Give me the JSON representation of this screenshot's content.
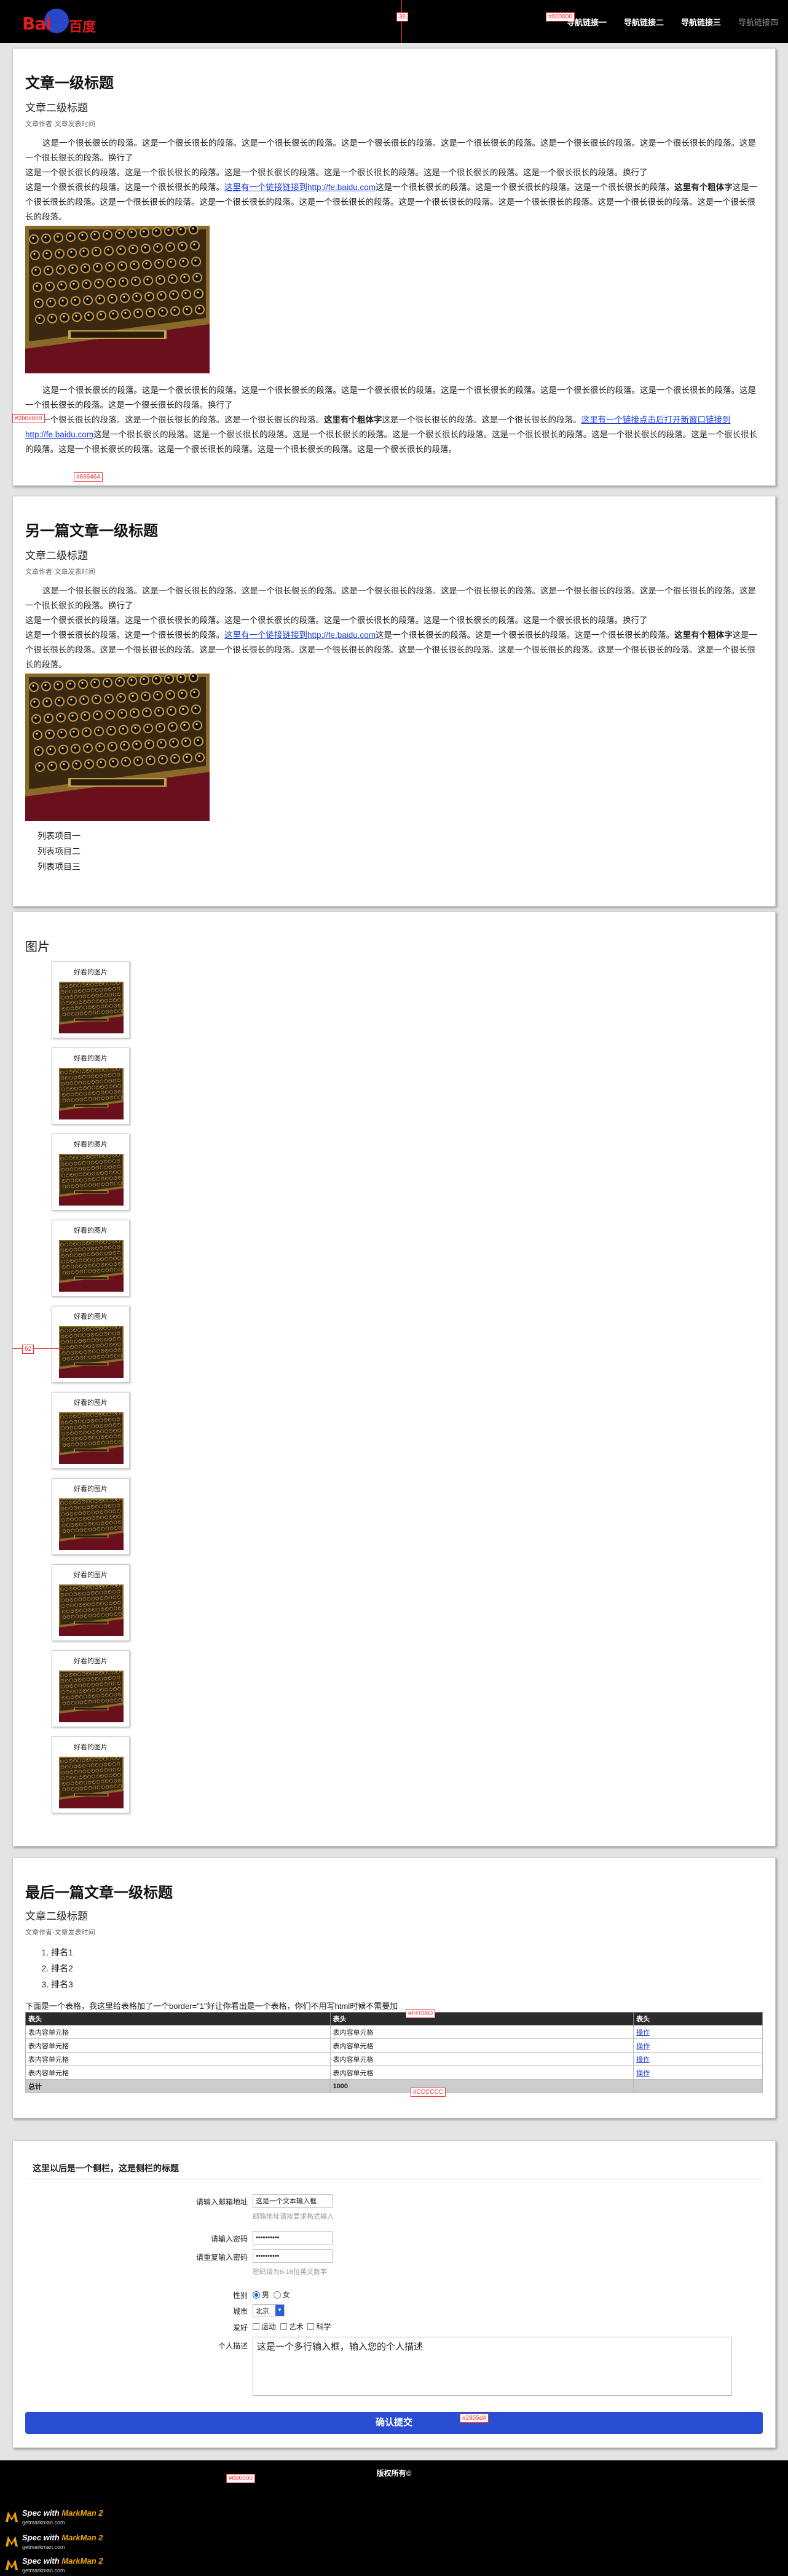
{
  "header": {
    "logo_text": "Bai",
    "logo_text2": "百度",
    "nav": [
      "导航链接一",
      "导航链接二",
      "导航链接三",
      "导航链接四"
    ]
  },
  "annotations": {
    "header_badge": "36",
    "header_color": "#000000",
    "card1_ann1": "#2b0e0e0",
    "card1_ann2": "#666464",
    "gallery_ann": "62",
    "table_ann": "#FF0000",
    "total_ann": "#CCCCCC",
    "form_ann": "#2855d4",
    "footer_color": "#000000"
  },
  "article1": {
    "title": "文章一级标题",
    "subtitle": "文章二级标题",
    "meta": "文章作者·文章发表时间",
    "p1": "这是一个很长很长的段落。这是一个很长很长的段落。这是一个很长很长的段落。这是一个很长很长的段落。这是一个很长很长的段落。这是一个很长很长的段落。这是一个很长很长的段落。这是一个很长很长的段落。换行了",
    "p2": "这是一个很长很长的段落。这是一个很长很长的段落。这是一个很长很长的段落。这是一个很长很长的段落。这是一个很长很长的段落。这是一个很长很长的段落。换行了",
    "p3a": "这是一个很长很长的段落。这是一个很长很长的段落。",
    "p3_link": "这里有一个链接链接到http://fe.baidu.com",
    "p3b": "这是一个很长很长的段落。这是一个很长很长的段落。这是一个很长很长的段落。",
    "p3_bold": "这里有个粗体字",
    "p3c": "这是一个很长很长的段落。这是一个很长很长的段落。这是一个很长很长的段落。这是一个很长很长的段落。这是一个很长很长的段落。这是一个很长很长的段落。这是一个很长很长的段落。这是一个很长很长的段落。",
    "p4": "这是一个很长很长的段落。这是一个很长很长的段落。这是一个很长很长的段落。这是一个很长很长的段落。这是一个很长很长的段落。这是一个很长很长的段落。这是一个很长很长的段落。这是一个很长很长的段落。这是一个很长很长的段落。换行了",
    "p5a": "这是一个很长很长的段落。这是一个很长很长的段落。这是一个很长很长的段落。",
    "p5_bold": "这里有个粗体字",
    "p5b": "这是一个很长很长的段落。这是一个很长很长的段落。",
    "p5_link": "这里有一个链接点击后打开新窗口链接到http://fe.baidu.com",
    "p5c": "这是一个很长很长的段落。这是一个很长很长的段落。这是一个很长很长的段落。这是一个很长很长的段落。这是一个很长很长的段落。这是一个很长很长的段落。这是一个很长很长的段落。这是一个很长很长的段落。这是一个很长很长的段落。这是一个很长很长的段落。这是一个很长很长的段落。"
  },
  "article2": {
    "title": "另一篇文章一级标题",
    "subtitle": "文章二级标题",
    "meta": "文章作者·文章发表时间",
    "p1": "这是一个很长很长的段落。这是一个很长很长的段落。这是一个很长很长的段落。这是一个很长很长的段落。这是一个很长很长的段落。这是一个很长很长的段落。这是一个很长很长的段落。这是一个很长很长的段落。换行了",
    "p2": "这是一个很长很长的段落。这是一个很长很长的段落。这是一个很长很长的段落。这是一个很长很长的段落。这是一个很长很长的段落。这是一个很长很长的段落。换行了",
    "p3a": "这是一个很长很长的段落。这是一个很长很长的段落。",
    "p3_link": "这里有一个链接链接到http://fe.baidu.com",
    "p3b": "这是一个很长很长的段落。这是一个很长很长的段落。这是一个很长很长的段落。",
    "p3_bold": "这里有个粗体字",
    "p3c": "这是一个很长很长的段落。这是一个很长很长的段落。这是一个很长很长的段落。这是一个很长很长的段落。这是一个很长很长的段落。这是一个很长很长的段落。这是一个很长很长的段落。这是一个很长很长的段落。",
    "list": [
      "列表项目一",
      "列表项目二",
      "列表项目三"
    ]
  },
  "gallery": {
    "title": "图片",
    "caption": "好看的图片"
  },
  "article3": {
    "title": "最后一篇文章一级标题",
    "subtitle": "文章二级标题",
    "meta": "文章作者·文章发表时间",
    "ranks": [
      "排名1",
      "排名2",
      "排名3"
    ],
    "table_intro": "下面是一个表格，我这里给表格加了一个border=\"1\"好让你看出是一个表格，你们不用写html时候不需要加",
    "table": {
      "headers": [
        "表头",
        "表头",
        "表头"
      ],
      "rows": [
        [
          "表内容单元格",
          "表内容单元格",
          "操作"
        ],
        [
          "表内容单元格",
          "表内容单元格",
          "操作"
        ],
        [
          "表内容单元格",
          "表内容单元格",
          "操作"
        ],
        [
          "表内容单元格",
          "表内容单元格",
          "操作"
        ]
      ],
      "total": [
        "总计",
        "1000",
        ""
      ]
    }
  },
  "form": {
    "title": "这里以后是一个侧栏，这是侧栏的标题",
    "email_label": "请输入邮箱地址",
    "email_value": "这是一个文本输入框",
    "email_hint": "邮箱地址请按要求格式输入",
    "pwd_label": "请输入密码",
    "pwd_value": "••••••••••",
    "repwd_label": "请重复输入密码",
    "repwd_value": "••••••••••",
    "pwd_hint": "密码请为6-16位英文数字",
    "gender_label": "性别",
    "gender_male": "男",
    "gender_female": "女",
    "city_label": "城市",
    "city_value": "北京",
    "hobby_label": "爱好",
    "hobbies": [
      "运动",
      "艺术",
      "科学"
    ],
    "desc_label": "个人描述",
    "desc_value": "这是一个多行输入框，输入您的个人描述",
    "submit": "确认提交"
  },
  "footer": {
    "copyright": "版权所有©",
    "markman_title": "Spec with ",
    "markman_brand": "MarkMan 2",
    "markman_url": "getmarkman.com"
  }
}
